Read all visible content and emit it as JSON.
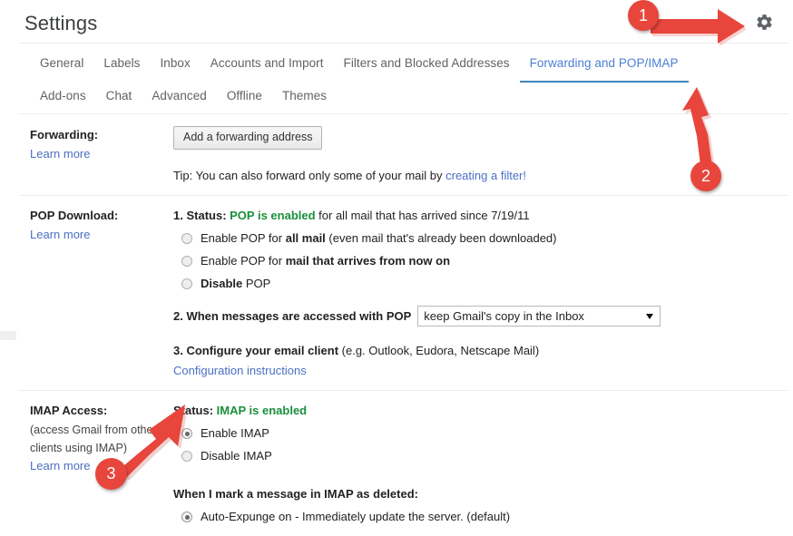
{
  "header": {
    "title": "Settings",
    "gear_icon": "gear-icon"
  },
  "tabs": {
    "row1": [
      {
        "label": "General",
        "active": false
      },
      {
        "label": "Labels",
        "active": false
      },
      {
        "label": "Inbox",
        "active": false
      },
      {
        "label": "Accounts and Import",
        "active": false
      },
      {
        "label": "Filters and Blocked Addresses",
        "active": false
      },
      {
        "label": "Forwarding and POP/IMAP",
        "active": true
      }
    ],
    "row2": [
      {
        "label": "Add-ons",
        "active": false
      },
      {
        "label": "Chat",
        "active": false
      },
      {
        "label": "Advanced",
        "active": false
      },
      {
        "label": "Offline",
        "active": false
      },
      {
        "label": "Themes",
        "active": false
      }
    ]
  },
  "sections": {
    "forwarding": {
      "label": "Forwarding:",
      "learn_more": "Learn more",
      "add_button": "Add a forwarding address",
      "tip_prefix": "Tip: You can also forward only some of your mail by ",
      "tip_link": "creating a filter!"
    },
    "pop": {
      "label": "POP Download:",
      "learn_more": "Learn more",
      "step1_number": "1. ",
      "step1_status_label": "Status: ",
      "step1_status_value": "POP is enabled",
      "step1_status_suffix": " for all mail that has arrived since 7/19/11",
      "options": [
        {
          "pre": "Enable POP for ",
          "bold": "all mail",
          "post": " (even mail that's already been downloaded)",
          "checked": false
        },
        {
          "pre": "Enable POP for ",
          "bold": "mail that arrives from now on",
          "post": "",
          "checked": false
        },
        {
          "pre": "",
          "bold": "Disable",
          "post": " POP",
          "checked": false
        }
      ],
      "step2_label": "2. When messages are accessed with POP",
      "step2_select_value": "keep Gmail's copy in the Inbox",
      "step3_bold": "3. Configure your email client",
      "step3_rest": " (e.g. Outlook, Eudora, Netscape Mail)",
      "step3_link": "Configuration instructions"
    },
    "imap": {
      "label": "IMAP Access:",
      "note_line1": "(access Gmail from other",
      "note_line2": "clients using IMAP)",
      "learn_more": "Learn more",
      "status_label": "Status: ",
      "status_value": "IMAP is enabled",
      "options": [
        {
          "text": "Enable IMAP",
          "checked": true
        },
        {
          "text": "Disable IMAP",
          "checked": false
        }
      ],
      "delete_heading": "When I mark a message in IMAP as deleted:",
      "delete_options": [
        {
          "text": "Auto-Expunge on - Immediately update the server. (default)",
          "checked": true
        }
      ]
    }
  },
  "annotations": {
    "badge1": "1",
    "badge2": "2",
    "badge3": "3",
    "color": "#e8453c"
  }
}
